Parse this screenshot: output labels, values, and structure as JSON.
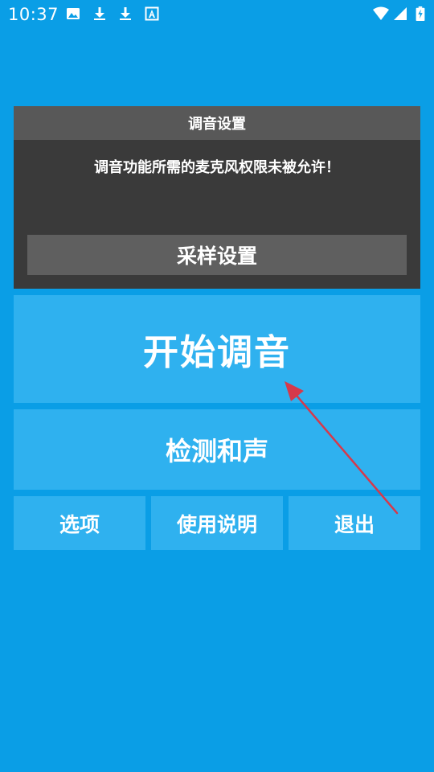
{
  "status_bar": {
    "time": "10:37",
    "left_icons": [
      "image-icon",
      "download-icon",
      "download-icon",
      "font-icon"
    ],
    "right_icons": [
      "wifi-icon",
      "signal-icon",
      "battery-charging-icon"
    ]
  },
  "dialog": {
    "title": "调音设置",
    "message": "调音功能所需的麦克风权限未被允许！",
    "button_label": "采样设置"
  },
  "buttons": {
    "start_tuning": "开始调音",
    "detect_chord": "检测和声",
    "options": "选项",
    "manual": "使用说明",
    "exit": "退出"
  },
  "colors": {
    "background": "#0a9ee6",
    "button": "#2fb1ef",
    "dialog_body": "#3a3a3a",
    "dialog_title": "#585858",
    "dialog_button": "#5f5f5f",
    "arrow": "#d6394b"
  }
}
